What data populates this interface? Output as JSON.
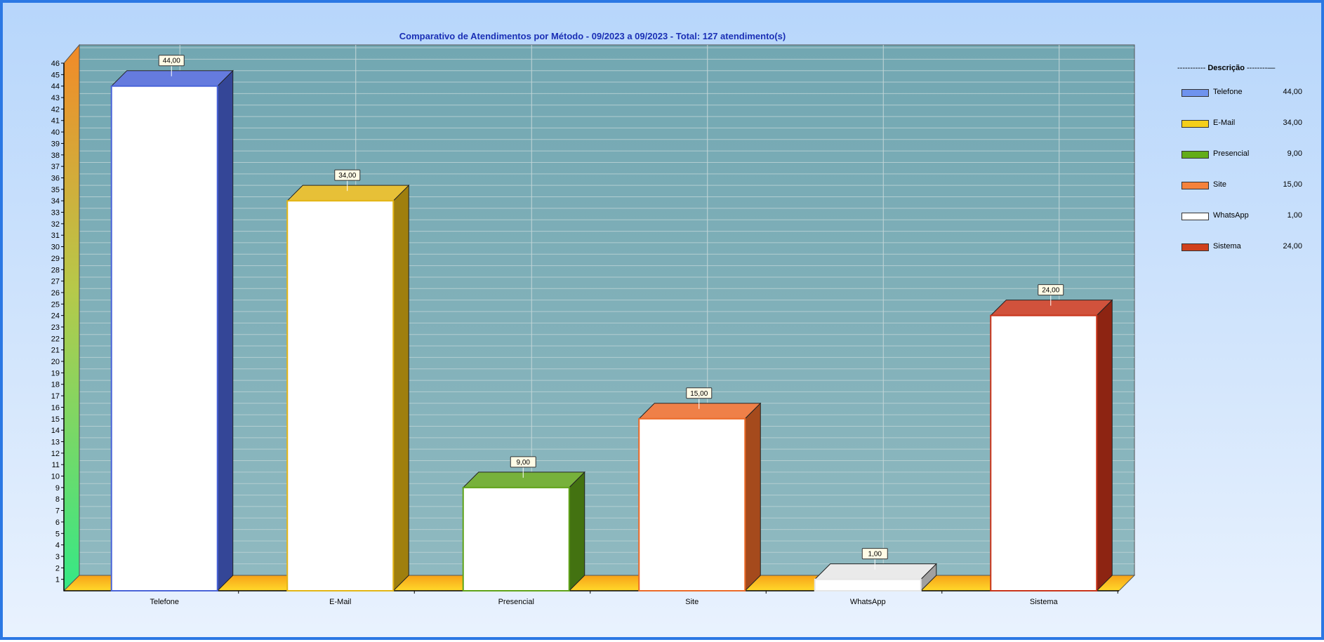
{
  "chart_data": {
    "type": "bar",
    "title": "Comparativo de Atendimentos por Método - 09/2023 a 09/2023 - Total: 127 atendimento(s)",
    "categories": [
      "Telefone",
      "E-Mail",
      "Presencial",
      "Site",
      "WhatsApp",
      "Sistema"
    ],
    "values": [
      44,
      34,
      9,
      15,
      1,
      24
    ],
    "value_labels": [
      "44,00",
      "34,00",
      "9,00",
      "15,00",
      "1,00",
      "24,00"
    ],
    "colors": [
      "#4a64d8",
      "#e3b514",
      "#5fa318",
      "#ec6a28",
      "#e6e6e6",
      "#c9341a"
    ],
    "ylim": [
      0,
      46
    ],
    "yticks": [
      1,
      2,
      3,
      4,
      5,
      6,
      7,
      8,
      9,
      10,
      11,
      12,
      13,
      14,
      15,
      16,
      17,
      18,
      19,
      20,
      21,
      22,
      23,
      24,
      25,
      26,
      27,
      28,
      29,
      30,
      31,
      32,
      33,
      34,
      35,
      36,
      37,
      38,
      39,
      40,
      41,
      42,
      43,
      44,
      45,
      46
    ],
    "grid": true,
    "three_d": true,
    "legend_position": "right"
  },
  "legend": {
    "title_left": "----------- ",
    "title_bold": "Descrição",
    "title_right": " --------—",
    "items": [
      {
        "label": "Telefone",
        "value": "44,00",
        "color": "#6f93ee"
      },
      {
        "label": "E-Mail",
        "value": "34,00",
        "color": "#f5cf1a"
      },
      {
        "label": "Presencial",
        "value": "9,00",
        "color": "#63ad18"
      },
      {
        "label": "Site",
        "value": "15,00",
        "color": "#f5823a"
      },
      {
        "label": "WhatsApp",
        "value": "1,00",
        "color": "#ffffff"
      },
      {
        "label": "Sistema",
        "value": "24,00",
        "color": "#d0401c"
      }
    ]
  }
}
